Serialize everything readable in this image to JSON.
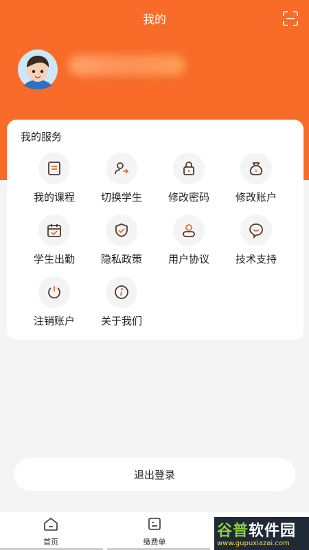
{
  "header": {
    "title": "我的",
    "accent_color": "#f86b28"
  },
  "profile": {
    "avatar_icon": "boy-avatar-icon"
  },
  "services": {
    "title": "我的服务",
    "items": [
      {
        "label": "我的课程",
        "icon": "book-icon"
      },
      {
        "label": "切换学生",
        "icon": "switch-user-icon"
      },
      {
        "label": "修改密码",
        "icon": "lock-icon"
      },
      {
        "label": "修改账户",
        "icon": "money-bag-icon"
      },
      {
        "label": "学生出勤",
        "icon": "calendar-check-icon"
      },
      {
        "label": "隐私政策",
        "icon": "shield-check-icon"
      },
      {
        "label": "用户协议",
        "icon": "user-icon"
      },
      {
        "label": "技术支持",
        "icon": "chat-heart-icon"
      },
      {
        "label": "注销账户",
        "icon": "power-icon"
      },
      {
        "label": "关于我们",
        "icon": "info-icon"
      }
    ]
  },
  "logout": {
    "label": "退出登录"
  },
  "tabbar": {
    "tabs": [
      {
        "label": "首页",
        "icon": "home-icon"
      },
      {
        "label": "缴费单",
        "icon": "bill-icon"
      }
    ]
  },
  "watermark": {
    "title_part1": "谷普",
    "title_part2": "软件园",
    "url": "www.gupuxiazai.com"
  }
}
